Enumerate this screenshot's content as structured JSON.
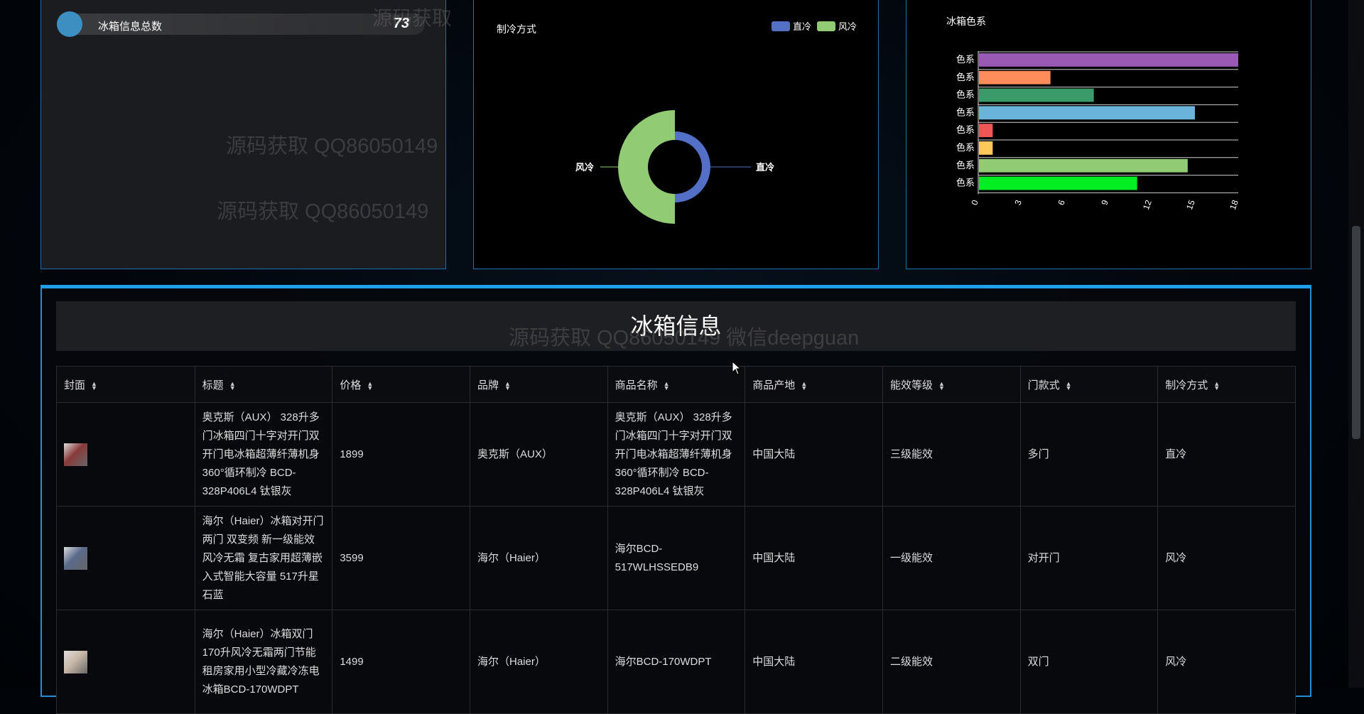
{
  "stats": {
    "label": "冰箱信息总数",
    "value": "73"
  },
  "cooling_chart": {
    "title": "制冷方式",
    "legend": [
      "直冷",
      "风冷"
    ],
    "labels": {
      "left": "风冷",
      "right": "直冷"
    },
    "colors": {
      "直冷": "#5470c6",
      "风冷": "#91cc75"
    }
  },
  "color_chart": {
    "title": "冰箱色系",
    "category_label_suffix": "色系",
    "x_ticks": [
      "0",
      "3",
      "6",
      "9",
      "12",
      "15",
      "18"
    ]
  },
  "chart_data": [
    {
      "type": "pie",
      "title": "制冷方式",
      "slices": [
        {
          "name": "直冷",
          "value": 24,
          "color": "#5470c6"
        },
        {
          "name": "风冷",
          "value": 49,
          "color": "#91cc75"
        }
      ]
    },
    {
      "type": "bar",
      "orientation": "horizontal",
      "title": "冰箱色系",
      "xlim": [
        0,
        18
      ],
      "values": [
        18,
        5,
        8,
        15,
        1,
        1,
        14.5,
        11
      ],
      "colors": [
        "#9b59b6",
        "#ff8c5a",
        "#3a9a6a",
        "#6ab4dc",
        "#ee5555",
        "#ffc85a",
        "#91cc75",
        "#00ee22"
      ]
    }
  ],
  "watermarks": [
    "源码获取",
    "源码获取 QQ86050149",
    "源码获取 QQ86050149",
    "源码获取 QQ86050149 微信deepguan"
  ],
  "table": {
    "title": "冰箱信息",
    "columns": [
      "封面",
      "标题",
      "价格",
      "品牌",
      "商品名称",
      "商品产地",
      "能效等级",
      "门款式",
      "制冷方式"
    ],
    "rows": [
      {
        "thumb_color": "#8a3a3a",
        "title": "奥克斯（AUX） 328升多门冰箱四门十字对开门双开门电冰箱超薄纤薄机身 360°循环制冷 BCD-328P406L4 钛银灰",
        "price": "1899",
        "brand": "奥克斯（AUX）",
        "name": "奥克斯（AUX） 328升多门冰箱四门十字对开门双开门电冰箱超薄纤薄机身 360°循环制冷 BCD-328P406L4 钛银灰",
        "origin": "中国大陆",
        "energy": "三级能效",
        "door": "多门",
        "cooling": "直冷"
      },
      {
        "thumb_color": "#5a6a8a",
        "title": "海尔（Haier）冰箱对开门两门 双变频 新一级能效风冷无霜 复古家用超薄嵌入式智能大容量 517升星石蓝",
        "price": "3599",
        "brand": "海尔（Haier）",
        "name": "海尔BCD-517WLHSSEDB9",
        "origin": "中国大陆",
        "energy": "一级能效",
        "door": "对开门",
        "cooling": "风冷"
      },
      {
        "thumb_color": "#c8b8a8",
        "title": "海尔（Haier）冰箱双门170升风冷无霜两门节能租房家用小型冷藏冷冻电冰箱BCD-170WDPT",
        "price": "1499",
        "brand": "海尔（Haier）",
        "name": "海尔BCD-170WDPT",
        "origin": "中国大陆",
        "energy": "二级能效",
        "door": "双门",
        "cooling": "风冷"
      }
    ]
  }
}
